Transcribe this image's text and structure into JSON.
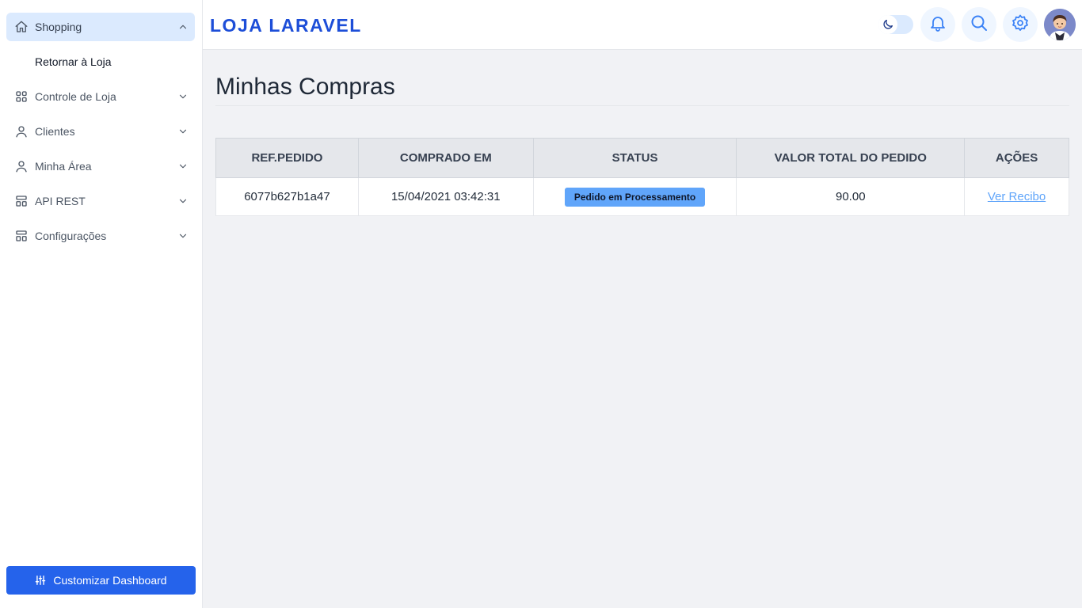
{
  "colors": {
    "accent": "#2563eb",
    "brand": "#1d4ed8",
    "active_nav_bg": "#dbeafe",
    "badge_bg": "#60a5fa",
    "link": "#60a5fa"
  },
  "sidebar": {
    "items": [
      {
        "label": "Shopping",
        "icon": "home-icon",
        "expanded": true
      },
      {
        "label": "Retornar à Loja"
      },
      {
        "label": "Controle de Loja",
        "icon": "grid-icon"
      },
      {
        "label": "Clientes",
        "icon": "user-icon"
      },
      {
        "label": "Minha Área",
        "icon": "user-icon"
      },
      {
        "label": "API REST",
        "icon": "layout-icon"
      },
      {
        "label": "Configurações",
        "icon": "layout-icon"
      }
    ],
    "customize_label": "Customizar Dashboard"
  },
  "header": {
    "brand": "LOJA LARAVEL"
  },
  "main": {
    "title": "Minhas Compras",
    "table": {
      "headers": [
        "REF.PEDIDO",
        "COMPRADO EM",
        "STATUS",
        "VALOR TOTAL DO PEDIDO",
        "AÇÕES"
      ],
      "rows": [
        {
          "ref": "6077b627b1a47",
          "date": "15/04/2021 03:42:31",
          "status": "Pedido em Processamento",
          "total": "90.00",
          "action": "Ver Recibo"
        }
      ]
    }
  }
}
